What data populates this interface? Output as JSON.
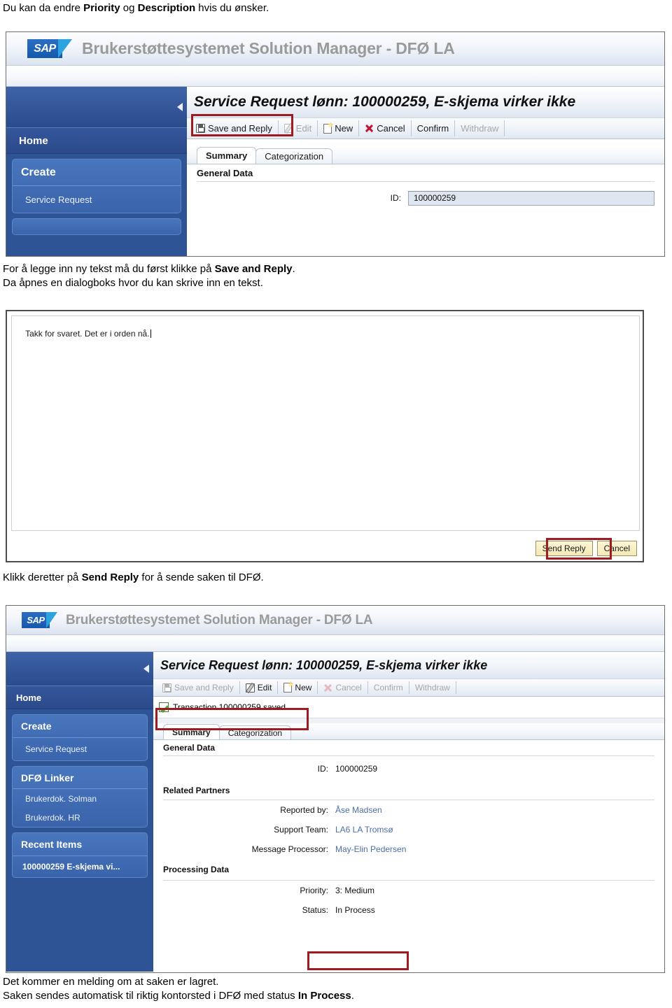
{
  "document": {
    "line1_a": "Du kan da endre ",
    "line1_b": "Priority",
    "line1_c": " og ",
    "line1_d": "Description",
    "line1_e": " hvis du ønsker.",
    "block2_l1_a": "For å legge inn ny tekst må du først klikke på ",
    "block2_l1_b": "Save and Reply",
    "block2_l1_c": ".",
    "block2_l2": "Da åpnes en dialogboks hvor du kan skrive inn en tekst.",
    "block3_a": "Klikk deretter på ",
    "block3_b": "Send Reply",
    "block3_c": " for å sende saken til DFØ.",
    "block4_l1": "Det kommer en melding om at saken er lagret.",
    "block4_l2_a": "Saken sendes automatisk til riktig kontorsted i DFØ med status ",
    "block4_l2_b": "In Process",
    "block4_l2_c": "."
  },
  "sap": {
    "brand": "SAP",
    "app_title": "Brukerstøttesystemet Solution Manager - DFØ LA",
    "page_title": "Service Request lønn: 100000259, E-skjema virker ikke",
    "toolbar": {
      "save_and_reply": "Save and Reply",
      "edit": "Edit",
      "new": "New",
      "cancel": "Cancel",
      "confirm": "Confirm",
      "withdraw": "Withdraw"
    },
    "tabs": {
      "summary": "Summary",
      "categorization": "Categorization"
    },
    "sections": {
      "general_data": "General Data",
      "related_partners": "Related Partners",
      "processing_data": "Processing Data"
    },
    "fields": {
      "id_label": "ID:",
      "id_value": "100000259",
      "reported_by_label": "Reported by:",
      "reported_by_value": "Åse Madsen",
      "support_team_label": "Support Team:",
      "support_team_value": "LA6 LA Tromsø",
      "message_processor_label": "Message Processor:",
      "message_processor_value": "May-Elin Pedersen",
      "priority_label": "Priority:",
      "priority_value": "3: Medium",
      "status_label": "Status:",
      "status_value": "In Process"
    },
    "message": "Transaction 100000259 saved",
    "nav": {
      "home": "Home",
      "create_title": "Create",
      "create_link": "Service Request",
      "links_title": "DFØ Linker",
      "link_solman": "Brukerdok. Solman",
      "link_hr": "Brukerdok. HR",
      "recent_title": "Recent Items",
      "recent_item": "100000259 E-skjema vi..."
    }
  },
  "dialog": {
    "text": "Takk for svaret. Det er i orden nå.",
    "send_reply": "Send Reply",
    "cancel": "Cancel"
  },
  "colors": {
    "nav_blue": "#2f5496",
    "annotation_red": "#9e1b21",
    "link_blue": "#4a6fa5",
    "sap_logo_blue": "#1558ab"
  }
}
